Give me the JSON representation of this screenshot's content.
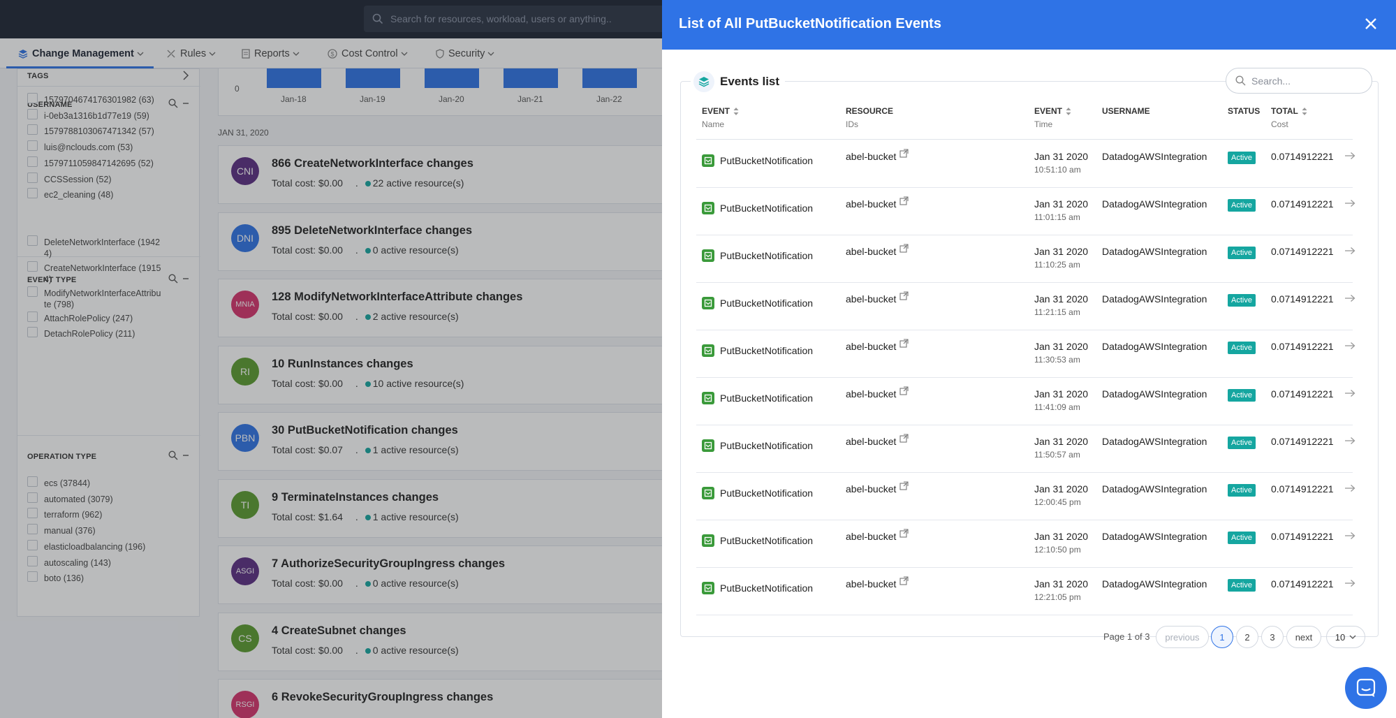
{
  "topbar": {
    "search_placeholder": "Search for resources, workload, users or anything.."
  },
  "nav": {
    "items": [
      {
        "label": "Change Management",
        "icon": "layers-icon"
      },
      {
        "label": "Rules",
        "icon": "tools-icon"
      },
      {
        "label": "Reports",
        "icon": "document-icon"
      },
      {
        "label": "Cost Control",
        "icon": "dollar-icon"
      },
      {
        "label": "Security",
        "icon": "shield-icon"
      }
    ],
    "active": "Change Management"
  },
  "sidebar": {
    "tags_title": "TAGS",
    "username": {
      "title": "USERNAME",
      "items": [
        "1579704674176301982 (63)",
        "i-0eb3a1316b1d77e19 (59)",
        "1579788103067471342 (57)",
        "luis@nclouds.com (53)",
        "1579711059847142695 (52)",
        "CCSSession (52)",
        "ec2_cleaning (48)"
      ]
    },
    "event_type": {
      "title": "EVENT TYPE",
      "items": [
        {
          "l1": "DeleteNetworkInterface (1942",
          "l2": "4)"
        },
        {
          "l1": "CreateNetworkInterface (1915",
          "l2": "4)"
        },
        {
          "l1": "ModifyNetworkInterfaceAttribu",
          "l2": "te (798)"
        },
        {
          "l1": "AttachRolePolicy (247)",
          "l2": ""
        },
        {
          "l1": "DetachRolePolicy (211)",
          "l2": ""
        }
      ]
    },
    "operation_type": {
      "title": "OPERATION TYPE",
      "items": [
        "ecs (37844)",
        "automated (3079)",
        "terraform (962)",
        "manual (376)",
        "elasticloadbalancing (196)",
        "autoscaling (143)",
        "boto (136)"
      ]
    }
  },
  "chart_data": {
    "type": "bar",
    "categories": [
      "Jan-18",
      "Jan-19",
      "Jan-20",
      "Jan-21",
      "Jan-22"
    ],
    "y_tick": "0"
  },
  "feed": {
    "date_heading": "JAN 31, 2020",
    "cards": [
      {
        "initials": "CNI",
        "color": "#5b2d82",
        "title": "866 CreateNetworkInterface changes",
        "cost": "Total cost: $0.00",
        "active": "22 active resource(s)"
      },
      {
        "initials": "DNI",
        "color": "#2f73e6",
        "title": "895 DeleteNetworkInterface changes",
        "cost": "Total cost: $0.00",
        "active": "0 active resource(s)"
      },
      {
        "initials": "MNIA",
        "color": "#d6336c",
        "title": "128 ModifyNetworkInterfaceAttribute changes",
        "cost": "Total cost: $0.00",
        "active": "2 active resource(s)"
      },
      {
        "initials": "RI",
        "color": "#5b9b2f",
        "title": "10 RunInstances changes",
        "cost": "Total cost: $0.00",
        "active": "10 active resource(s)"
      },
      {
        "initials": "PBN",
        "color": "#2f73e6",
        "title": "30 PutBucketNotification changes",
        "cost": "Total cost: $0.07",
        "active": "1 active resource(s)"
      },
      {
        "initials": "TI",
        "color": "#5b9b2f",
        "title": "9 TerminateInstances changes",
        "cost": "Total cost: $1.64",
        "active": "1 active resource(s)"
      },
      {
        "initials": "ASGI",
        "color": "#5b2d82",
        "title": "7 AuthorizeSecurityGroupIngress changes",
        "cost": "Total cost: $0.00",
        "active": "0 active resource(s)"
      },
      {
        "initials": "CS",
        "color": "#5b9b2f",
        "title": "4 CreateSubnet changes",
        "cost": "Total cost: $0.00",
        "active": "0 active resource(s)"
      },
      {
        "initials": "RSGI",
        "color": "#d6336c",
        "title": "6 RevokeSecurityGroupIngress changes",
        "cost": "",
        "active": ""
      }
    ]
  },
  "panel": {
    "title": "List of All PutBucketNotification Events",
    "section_label": "Events list",
    "search_placeholder": "Search...",
    "columns": [
      {
        "main": "EVENT",
        "sub": "Name",
        "sortable": true
      },
      {
        "main": "RESOURCE",
        "sub": "IDs",
        "sortable": false
      },
      {
        "main": "EVENT",
        "sub": "Time",
        "sortable": true
      },
      {
        "main": "USERNAME",
        "sub": "",
        "sortable": false
      },
      {
        "main": "STATUS",
        "sub": "",
        "sortable": false
      },
      {
        "main": "TOTAL",
        "sub": "Cost",
        "sortable": true
      }
    ],
    "rows": [
      {
        "name": "PutBucketNotification",
        "resource": "abel-bucket",
        "date": "Jan 31 2020",
        "time": "10:51:10 am",
        "user": "DatadogAWSIntegration",
        "status": "Active",
        "cost": "0.0714912221"
      },
      {
        "name": "PutBucketNotification",
        "resource": "abel-bucket",
        "date": "Jan 31 2020",
        "time": "11:01:15 am",
        "user": "DatadogAWSIntegration",
        "status": "Active",
        "cost": "0.0714912221"
      },
      {
        "name": "PutBucketNotification",
        "resource": "abel-bucket",
        "date": "Jan 31 2020",
        "time": "11:10:25 am",
        "user": "DatadogAWSIntegration",
        "status": "Active",
        "cost": "0.0714912221"
      },
      {
        "name": "PutBucketNotification",
        "resource": "abel-bucket",
        "date": "Jan 31 2020",
        "time": "11:21:15 am",
        "user": "DatadogAWSIntegration",
        "status": "Active",
        "cost": "0.0714912221"
      },
      {
        "name": "PutBucketNotification",
        "resource": "abel-bucket",
        "date": "Jan 31 2020",
        "time": "11:30:53 am",
        "user": "DatadogAWSIntegration",
        "status": "Active",
        "cost": "0.0714912221"
      },
      {
        "name": "PutBucketNotification",
        "resource": "abel-bucket",
        "date": "Jan 31 2020",
        "time": "11:41:09 am",
        "user": "DatadogAWSIntegration",
        "status": "Active",
        "cost": "0.0714912221"
      },
      {
        "name": "PutBucketNotification",
        "resource": "abel-bucket",
        "date": "Jan 31 2020",
        "time": "11:50:57 am",
        "user": "DatadogAWSIntegration",
        "status": "Active",
        "cost": "0.0714912221"
      },
      {
        "name": "PutBucketNotification",
        "resource": "abel-bucket",
        "date": "Jan 31 2020",
        "time": "12:00:45 pm",
        "user": "DatadogAWSIntegration",
        "status": "Active",
        "cost": "0.0714912221"
      },
      {
        "name": "PutBucketNotification",
        "resource": "abel-bucket",
        "date": "Jan 31 2020",
        "time": "12:10:50 pm",
        "user": "DatadogAWSIntegration",
        "status": "Active",
        "cost": "0.0714912221"
      },
      {
        "name": "PutBucketNotification",
        "resource": "abel-bucket",
        "date": "Jan 31 2020",
        "time": "12:21:05 pm",
        "user": "DatadogAWSIntegration",
        "status": "Active",
        "cost": "0.0714912221"
      }
    ],
    "pagination": {
      "info": "Page 1 of 3",
      "previous": "previous",
      "pages": [
        "1",
        "2",
        "3"
      ],
      "current": "1",
      "next": "next",
      "page_size": "10"
    }
  },
  "colors": {
    "accent": "#2f73e6",
    "status_active": "#15a6a0",
    "topbar": "#1d2433"
  }
}
